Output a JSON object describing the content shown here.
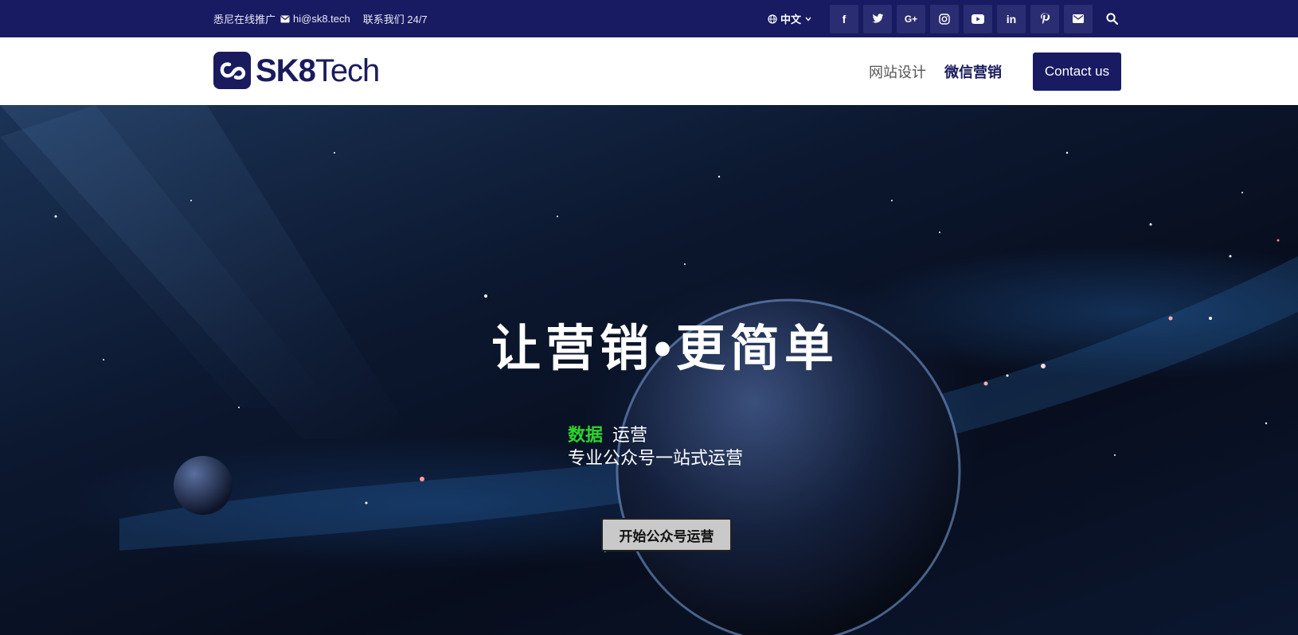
{
  "topbar": {
    "tagline": "悉尼在线推广",
    "email": "hi@sk8.tech",
    "contact": "联系我们 24/7",
    "language": "中文",
    "social_icons": [
      "facebook-icon",
      "twitter-icon",
      "google-plus-icon",
      "instagram-icon",
      "youtube-icon",
      "linkedin-icon",
      "pinterest-icon",
      "mail-icon"
    ],
    "social_labels": {
      "facebook": "f",
      "googleplus": "G+",
      "linkedin": "in"
    },
    "bar_color": "#181a62"
  },
  "header": {
    "logo": {
      "bold": "SK8",
      "light": "Tech"
    },
    "nav": [
      {
        "label": "网站设计"
      },
      {
        "label": "微信营销"
      }
    ],
    "cta_label": "Contact us",
    "brand_color": "#1a1b5e"
  },
  "hero": {
    "title": "让营销•更简单",
    "highlight": "数据",
    "line1": "运营",
    "line2": "专业公众号一站式运营",
    "button_label": "开始公众号运营",
    "highlight_color": "#2bd62b"
  }
}
